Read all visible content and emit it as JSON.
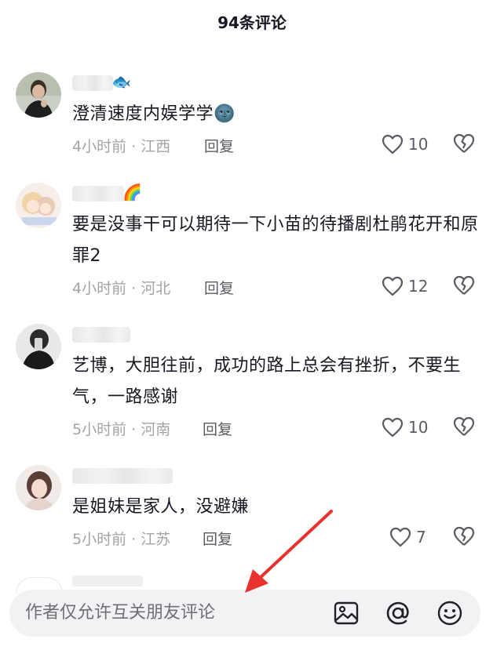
{
  "header": {
    "title": "94条评论"
  },
  "comments": [
    {
      "text": "澄清速度内娱学学",
      "text_emoji": "🌚",
      "name_emoji": "🐟",
      "time_loc": "4小时前 · 江西",
      "reply": "回复",
      "likes": "10"
    },
    {
      "text": "要是没事干可以期待一下小苗的待播剧杜鹃花开和原罪2",
      "name_emoji": "🌈",
      "time_loc": "4小时前 · 河北",
      "reply": "回复",
      "likes": "12"
    },
    {
      "text": "艺博，大胆往前，成功的路上总会有挫折，不要生气，一路感谢",
      "time_loc": "5小时前 · 河南",
      "reply": "回复",
      "likes": "10"
    },
    {
      "text": "是姐妹是家人，没避嫌",
      "time_loc": "5小时前 · 江苏",
      "reply": "回复",
      "likes": "7"
    }
  ],
  "input": {
    "placeholder": "作者仅允许互关朋友评论"
  },
  "icons": {
    "like": "heart-outline-icon",
    "dislike": "broken-heart-icon",
    "image": "image-icon",
    "mention": "at-icon",
    "emoji": "smiley-icon"
  },
  "colors": {
    "annotation_arrow": "#e8322f",
    "placeholder": "#6f7077",
    "meta": "#a3a4a8"
  }
}
